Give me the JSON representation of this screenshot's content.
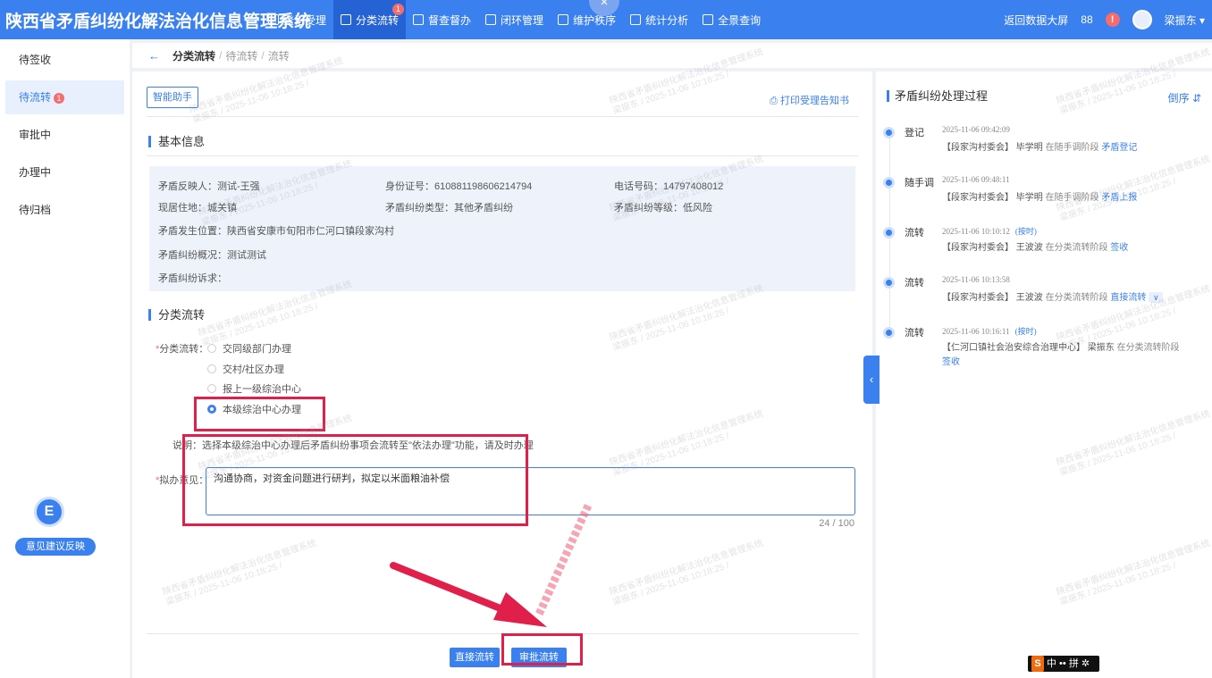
{
  "app": {
    "title": "陕西省矛盾纠纷化解法治化信息管理系统"
  },
  "nav": [
    {
      "label": "登记受理",
      "icon": "register-icon"
    },
    {
      "label": "分类流转",
      "icon": "transfer-icon",
      "badge": "1",
      "active": true
    },
    {
      "label": "督查督办",
      "icon": "supervise-icon"
    },
    {
      "label": "闭环管理",
      "icon": "loop-icon"
    },
    {
      "label": "维护秩序",
      "icon": "order-icon"
    },
    {
      "label": "统计分析",
      "icon": "stats-icon"
    },
    {
      "label": "全景查询",
      "icon": "query-icon"
    }
  ],
  "popup_close": "×",
  "topright": {
    "back": "返回数据大屏",
    "grid_icon": "88",
    "alert": "!",
    "user": "梁振东 ▾"
  },
  "sidebar": {
    "items": [
      {
        "label": "待签收"
      },
      {
        "label": "待流转",
        "badge": "1"
      },
      {
        "label": "审批中"
      },
      {
        "label": "办理中"
      },
      {
        "label": "待归档"
      }
    ],
    "feedback": {
      "icon": "E",
      "label": "意见建议反映"
    }
  },
  "breadcrumb": {
    "back": "←",
    "current": "分类流转",
    "sep": "/",
    "level2": "待流转",
    "level3": "流转"
  },
  "main": {
    "assistant_button": "智能助手",
    "print_link": "⎙ 打印受理告知书",
    "basic_info_title": "基本信息",
    "info": {
      "reporter": "矛盾反映人：测试-王强",
      "id_no": "身份证号：610881198606214794",
      "phone": "电话号码：14797408012",
      "address": "现居住地：城关镇",
      "dispute_type": "矛盾纠纷类型：其他矛盾纠纷",
      "dispute_level": "矛盾纠纷等级：低风险",
      "location": "矛盾发生位置：陕西省安康市旬阳市仁河口镇段家沟村",
      "overview": "矛盾纠纷概况：测试测试",
      "appeal": "矛盾纠纷诉求："
    },
    "transfer_title": "分类流转",
    "transfer_label": "分类流转：",
    "options": [
      {
        "label": "交同级部门办理",
        "checked": false
      },
      {
        "label": "交村/社区办理",
        "checked": false
      },
      {
        "label": "报上一级综治中心",
        "checked": false
      },
      {
        "label": "本级综治中心办理",
        "checked": true
      }
    ],
    "note": "说明：选择本级综治中心办理后矛盾纠纷事项会流转至\"依法办理\"功能，请及时办理",
    "opinion_label": "拟办意见：",
    "opinion_value": "沟通协商，对资金问题进行研判，拟定以米面粮油补偿",
    "counter": "24 / 100",
    "btn_direct": "直接流转",
    "btn_approve": "审批流转"
  },
  "process": {
    "title": "矛盾纠纷处理过程",
    "sort": "倒序 ⇵",
    "items": [
      {
        "type": "登记",
        "time": "2025-11-06 09:42:09",
        "ontime": "",
        "org": "【段家沟村委会】",
        "person": "毕学明",
        "stage": "在随手调阶段",
        "action": "矛盾登记"
      },
      {
        "type": "随手调",
        "time": "2025-11-06 09:48:11",
        "ontime": "",
        "org": "【段家沟村委会】",
        "person": "毕学明",
        "stage": "在随手调阶段",
        "action": "矛盾上报"
      },
      {
        "type": "流转",
        "time": "2025-11-06 10:10:12",
        "ontime": "(按时)",
        "org": "【段家沟村委会】",
        "person": "王波波",
        "stage": "在分类流转阶段",
        "action": "签收"
      },
      {
        "type": "流转",
        "time": "2025-11-06 10:13:58",
        "ontime": "",
        "org": "【段家沟村委会】",
        "person": "王波波",
        "stage": "在分类流转阶段",
        "action": "直接流转"
      },
      {
        "type": "流转",
        "time": "2025-11-06 10:16:11",
        "ontime": "(按时)",
        "org": "【仁河口镇社会治安综合治理中心】",
        "person": "梁振东",
        "stage": "在分类流转阶段",
        "action": "签收"
      }
    ]
  },
  "watermark": {
    "line1": "陕西省矛盾纠纷化解法治化信息管理系统",
    "line2": "梁振东 / 2025-11-06 10:18:25 /"
  },
  "ime": {
    "logo": "S",
    "text": "中 •• 拼 ✲"
  },
  "colors": {
    "primary": "#3a80ef",
    "highlight_red": "#e0204a",
    "badge_red": "#f56c6c"
  }
}
